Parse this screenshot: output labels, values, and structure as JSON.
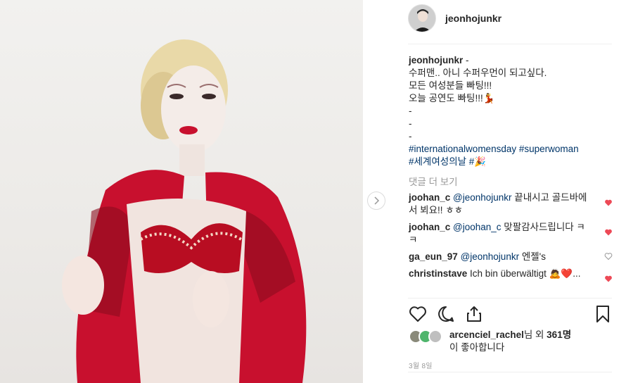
{
  "post": {
    "username": "jeonhojunkr",
    "caption": {
      "username": "jeonhojunkr",
      "dash": "-",
      "lines": [
        "수퍼맨.. 아니 수퍼우먼이 되고싶다.",
        "모든 여성분들 빠팅!!!",
        "오늘 공연도 빠팅!!!💃",
        "-",
        "-",
        "-"
      ],
      "hashtags_line1": [
        "#internationalwomensday",
        "#superwoman"
      ],
      "hashtags_line2": [
        "#세계여성의날",
        "#🎉"
      ]
    },
    "view_more_comments": "댓글 더 보기",
    "comments": [
      {
        "user": "joohan_c",
        "mention": "@jeonhojunkr",
        "text": " 끝내시고 골드바에서 뵈요!! ㅎㅎ",
        "liked": true
      },
      {
        "user": "joohan_c",
        "mention": "@joohan_c",
        "text": " 맞팔감사드립니다 ㅋㅋ",
        "liked": true
      },
      {
        "user": "ga_eun_97",
        "mention": "@jeonhojunkr",
        "text": " 엔젤's",
        "liked": false
      },
      {
        "user": "christinstave",
        "mention": "",
        "text": " Ich bin überwältigt 🙇❤️...",
        "liked": true
      }
    ],
    "likes": {
      "user": "arcenciel_rachel",
      "middle": "님 외 ",
      "count": "361명",
      "suffix": "이 좋아합니다"
    },
    "date": "3월 8일",
    "colors": {
      "heart_liked": "#ed4956",
      "link": "#003569",
      "muted": "#999999"
    },
    "icons": {
      "next": "chevron-right-icon",
      "like": "heart-outline-icon",
      "comment": "comment-bubble-icon",
      "share": "share-icon",
      "save": "bookmark-icon"
    }
  }
}
